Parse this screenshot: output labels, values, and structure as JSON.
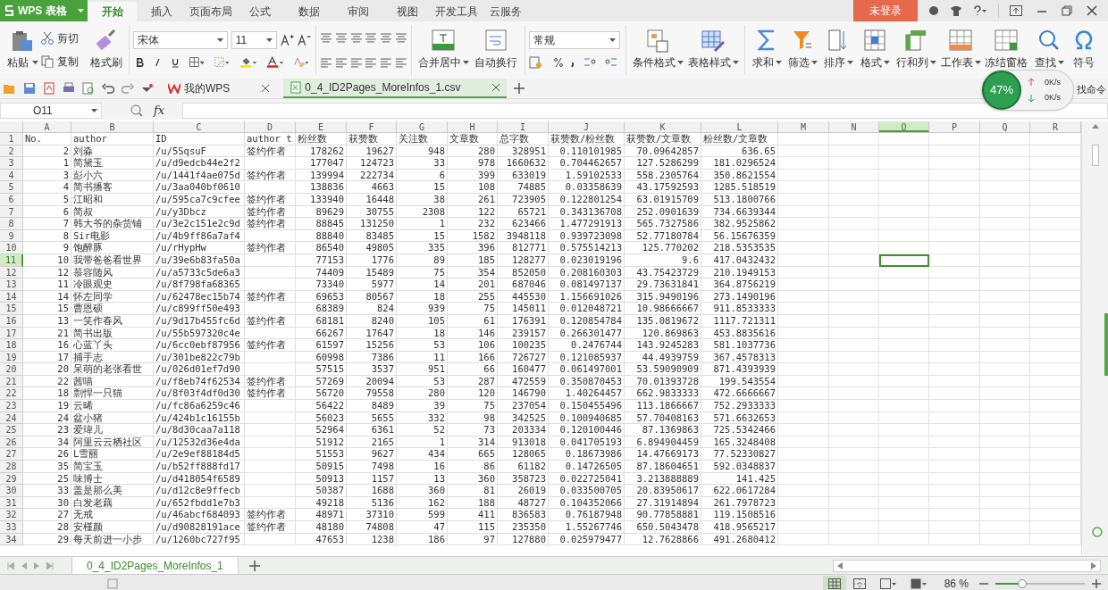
{
  "app": {
    "title": "WPS 表格"
  },
  "menu_tabs": [
    {
      "label": "开始",
      "selected": true
    },
    {
      "label": "插入",
      "selected": false
    },
    {
      "label": "页面布局",
      "selected": false
    },
    {
      "label": "公式",
      "selected": false
    },
    {
      "label": "数据",
      "selected": false
    },
    {
      "label": "审阅",
      "selected": false
    },
    {
      "label": "视图",
      "selected": false
    },
    {
      "label": "开发工具",
      "selected": false
    },
    {
      "label": "云服务",
      "selected": false
    }
  ],
  "account_button": "未登录",
  "ribbon": {
    "paste": "粘贴",
    "cut": "剪切",
    "copy": "复制",
    "format_painter": "格式刷",
    "font": "宋体",
    "font_size": "11",
    "merge": "合并居中",
    "merge_caret": true,
    "wrap": "自动换行",
    "number_format": "常规",
    "tools": [
      {
        "label": "条件格式",
        "caret": true
      },
      {
        "label": "表格样式",
        "caret": true
      }
    ],
    "edit_tools": [
      {
        "kind": "sum",
        "label": "求和",
        "caret": true
      },
      {
        "kind": "filter",
        "label": "筛选",
        "caret": true
      },
      {
        "kind": "sort",
        "label": "排序",
        "caret": true
      },
      {
        "kind": "format",
        "label": "格式",
        "caret": true
      },
      {
        "kind": "rowcol",
        "label": "行和列",
        "caret": true
      },
      {
        "kind": "sheet",
        "label": "工作表",
        "caret": true
      },
      {
        "kind": "freeze",
        "label": "冻结窗格",
        "caret": false
      },
      {
        "kind": "find",
        "label": "查找",
        "caret": true
      },
      {
        "kind": "symbol",
        "label": "符号",
        "caret": false
      }
    ]
  },
  "network_widget": {
    "percent": "47%",
    "upload": "0K/s",
    "download": "0K/s"
  },
  "find_command": "找命令",
  "doc_tabs": [
    {
      "label": "我的WPS",
      "selected": false
    },
    {
      "label": "0_4_ID2Pages_MoreInfos_1.csv",
      "selected": true
    }
  ],
  "formula_bar": {
    "name_box": "O11",
    "fx": "fx"
  },
  "sheet": {
    "columns": [
      {
        "label": "A",
        "selected": false
      },
      {
        "label": "B",
        "selected": false
      },
      {
        "label": "C",
        "selected": false
      },
      {
        "label": "D",
        "selected": false
      },
      {
        "label": "E",
        "selected": false
      },
      {
        "label": "F",
        "selected": false
      },
      {
        "label": "G",
        "selected": false
      },
      {
        "label": "H",
        "selected": false
      },
      {
        "label": "I",
        "selected": false
      },
      {
        "label": "J",
        "selected": false
      },
      {
        "label": "K",
        "selected": false
      },
      {
        "label": "L",
        "selected": false
      },
      {
        "label": "M",
        "selected": false
      },
      {
        "label": "N",
        "selected": false
      },
      {
        "label": "O",
        "selected": true
      },
      {
        "label": "P",
        "selected": false
      },
      {
        "label": "Q",
        "selected": false
      },
      {
        "label": "R",
        "selected": false
      }
    ],
    "rows": [
      {
        "header": "1",
        "selected": false,
        "kind": "heading",
        "cells": {
          "A": "No.",
          "B": "author",
          "C": "ID",
          "D": "author t",
          "E": "粉丝数",
          "F": "获赞数",
          "G": "关注数",
          "H": "文章数",
          "I": "总字数",
          "J": "获赞数/粉丝数",
          "K": "获赞数/文章数",
          "L": "粉丝数/文章数"
        }
      },
      {
        "header": "2",
        "selected": false,
        "kind": "data",
        "cells": {
          "A": "2",
          "B": "刘淼",
          "C": "/u/5SqsuF",
          "D": "签约作者",
          "E": "178262",
          "F": "19627",
          "G": "948",
          "H": "280",
          "I": "328951",
          "J": "0.110101985",
          "K": "70.09642857",
          "L": "636.65"
        }
      },
      {
        "header": "3",
        "selected": false,
        "kind": "data",
        "cells": {
          "A": "1",
          "B": "简黛玉",
          "C": "/u/d9edcb44e2f2",
          "E": "177047",
          "F": "124723",
          "G": "33",
          "H": "978",
          "I": "1660632",
          "J": "0.704462657",
          "K": "127.5286299",
          "L": "181.0296524"
        }
      },
      {
        "header": "4",
        "selected": false,
        "kind": "data",
        "cells": {
          "A": "3",
          "B": "彭小六",
          "C": "/u/1441f4ae075d",
          "D": "签约作者",
          "E": "139994",
          "F": "222734",
          "G": "6",
          "H": "399",
          "I": "633019",
          "J": "1.59102533",
          "K": "558.2305764",
          "L": "350.8621554"
        }
      },
      {
        "header": "5",
        "selected": false,
        "kind": "data",
        "cells": {
          "A": "4",
          "B": "简书播客",
          "C": "/u/3aa040bf0610",
          "E": "138836",
          "F": "4663",
          "G": "15",
          "H": "108",
          "I": "74885",
          "J": "0.03358639",
          "K": "43.17592593",
          "L": "1285.518519"
        }
      },
      {
        "header": "6",
        "selected": false,
        "kind": "data",
        "cells": {
          "A": "5",
          "B": "江昭和",
          "C": "/u/595ca7c9cfee",
          "D": "签约作者",
          "E": "133940",
          "F": "16448",
          "G": "38",
          "H": "261",
          "I": "723905",
          "J": "0.122801254",
          "K": "63.01915709",
          "L": "513.1800766"
        }
      },
      {
        "header": "7",
        "selected": false,
        "kind": "data",
        "cells": {
          "A": "6",
          "B": "简叔",
          "C": "/u/y3Dbcz",
          "D": "签约作者",
          "E": "89629",
          "F": "30755",
          "G": "2308",
          "H": "122",
          "I": "65721",
          "J": "0.343136708",
          "K": "252.0901639",
          "L": "734.6639344"
        }
      },
      {
        "header": "8",
        "selected": false,
        "kind": "data",
        "cells": {
          "A": "7",
          "B": "韩大爷的杂货铺",
          "C": "/u/3e2c151e2c9d",
          "D": "签约作者",
          "E": "88845",
          "F": "131250",
          "G": "1",
          "H": "232",
          "I": "623466",
          "J": "1.477291913",
          "K": "565.7327586",
          "L": "382.9525862"
        }
      },
      {
        "header": "9",
        "selected": false,
        "kind": "data",
        "cells": {
          "A": "8",
          "B": "Sir电影",
          "C": "/u/4b9ff86a7af4",
          "E": "88840",
          "F": "83485",
          "G": "15",
          "H": "1582",
          "I": "3948118",
          "J": "0.939723098",
          "K": "52.77180784",
          "L": "56.15676359"
        }
      },
      {
        "header": "10",
        "selected": false,
        "kind": "data",
        "cells": {
          "A": "9",
          "B": "饱醉豚",
          "C": "/u/rHypHw",
          "D": "签约作者",
          "E": "86540",
          "F": "49805",
          "G": "335",
          "H": "396",
          "I": "812771",
          "J": "0.575514213",
          "K": "125.770202",
          "L": "218.5353535"
        }
      },
      {
        "header": "11",
        "selected": true,
        "kind": "data",
        "cells": {
          "A": "10",
          "B": "我带爸爸看世界",
          "C": "/u/39e6b83fa50a",
          "E": "77153",
          "F": "1776",
          "G": "89",
          "H": "185",
          "I": "128277",
          "J": "0.023019196",
          "K": "9.6",
          "L": "417.0432432"
        }
      },
      {
        "header": "12",
        "selected": false,
        "kind": "data",
        "cells": {
          "A": "12",
          "B": "慕容随风",
          "C": "/u/a5733c5de6a3",
          "E": "74409",
          "F": "15489",
          "G": "75",
          "H": "354",
          "I": "852050",
          "J": "0.208160303",
          "K": "43.75423729",
          "L": "210.1949153"
        }
      },
      {
        "header": "13",
        "selected": false,
        "kind": "data",
        "cells": {
          "A": "11",
          "B": "冷眼观史",
          "C": "/u/8f798fa68365",
          "E": "73340",
          "F": "5977",
          "G": "14",
          "H": "201",
          "I": "687046",
          "J": "0.081497137",
          "K": "29.73631841",
          "L": "364.8756219"
        }
      },
      {
        "header": "14",
        "selected": false,
        "kind": "data",
        "cells": {
          "A": "14",
          "B": "怀左同学",
          "C": "/u/62478ec15b74",
          "D": "签约作者",
          "E": "69653",
          "F": "80567",
          "G": "18",
          "H": "255",
          "I": "445530",
          "J": "1.156691026",
          "K": "315.9490196",
          "L": "273.1490196"
        }
      },
      {
        "header": "15",
        "selected": false,
        "kind": "data",
        "cells": {
          "A": "15",
          "B": "曹恩硕",
          "C": "/u/c899ff50e493",
          "E": "68389",
          "F": "824",
          "G": "939",
          "H": "75",
          "I": "145011",
          "J": "0.012048721",
          "K": "10.98666667",
          "L": "911.8533333"
        }
      },
      {
        "header": "16",
        "selected": false,
        "kind": "data",
        "cells": {
          "A": "13",
          "B": "一笑作春风",
          "C": "/u/9d17b455fc6d",
          "D": "签约作者",
          "E": "68181",
          "F": "8240",
          "G": "105",
          "H": "61",
          "I": "176391",
          "J": "0.120854784",
          "K": "135.0819672",
          "L": "1117.721311"
        }
      },
      {
        "header": "17",
        "selected": false,
        "kind": "data",
        "cells": {
          "A": "21",
          "B": "简书出版",
          "C": "/u/55b597320c4e",
          "E": "66267",
          "F": "17647",
          "G": "18",
          "H": "146",
          "I": "239157",
          "J": "0.266301477",
          "K": "120.869863",
          "L": "453.8835616"
        }
      },
      {
        "header": "18",
        "selected": false,
        "kind": "data",
        "cells": {
          "A": "16",
          "B": "心蓝丫头",
          "C": "/u/6cc0ebf87956",
          "D": "签约作者",
          "E": "61597",
          "F": "15256",
          "G": "53",
          "H": "106",
          "I": "100235",
          "J": "0.2476744",
          "K": "143.9245283",
          "L": "581.1037736"
        }
      },
      {
        "header": "19",
        "selected": false,
        "kind": "data",
        "cells": {
          "A": "17",
          "B": "捕手志",
          "C": "/u/301be822c79b",
          "E": "60998",
          "F": "7386",
          "G": "11",
          "H": "166",
          "I": "726727",
          "J": "0.121085937",
          "K": "44.4939759",
          "L": "367.4578313"
        }
      },
      {
        "header": "20",
        "selected": false,
        "kind": "data",
        "cells": {
          "A": "20",
          "B": "呆萌的老张看世",
          "C": "/u/026d01ef7d90",
          "E": "57515",
          "F": "3537",
          "G": "951",
          "H": "66",
          "I": "160477",
          "J": "0.061497001",
          "K": "53.59090909",
          "L": "871.4393939"
        }
      },
      {
        "header": "21",
        "selected": false,
        "kind": "data",
        "cells": {
          "A": "22",
          "B": "茜喵",
          "C": "/u/f8eb74f62534",
          "D": "签约作者",
          "E": "57269",
          "F": "20094",
          "G": "53",
          "H": "287",
          "I": "472559",
          "J": "0.350870453",
          "K": "70.01393728",
          "L": "199.543554"
        }
      },
      {
        "header": "22",
        "selected": false,
        "kind": "data",
        "cells": {
          "A": "18",
          "B": "剽悍一只猫",
          "C": "/u/8f03f4df0d30",
          "D": "签约作者",
          "E": "56720",
          "F": "79558",
          "G": "280",
          "H": "120",
          "I": "146790",
          "J": "1.40264457",
          "K": "662.9833333",
          "L": "472.6666667"
        }
      },
      {
        "header": "23",
        "selected": false,
        "kind": "data",
        "cells": {
          "A": "19",
          "B": "云晞",
          "C": "/u/fc86a6259c46",
          "E": "56422",
          "F": "8489",
          "G": "39",
          "H": "75",
          "I": "237054",
          "J": "0.150455496",
          "K": "113.1866667",
          "L": "752.2933333"
        }
      },
      {
        "header": "24",
        "selected": false,
        "kind": "data",
        "cells": {
          "A": "24",
          "B": "盆小猪",
          "C": "/u/424b1c16155b",
          "E": "56023",
          "F": "5655",
          "G": "332",
          "H": "98",
          "I": "342525",
          "J": "0.100940685",
          "K": "57.70408163",
          "L": "571.6632653"
        }
      },
      {
        "header": "25",
        "selected": false,
        "kind": "data",
        "cells": {
          "A": "23",
          "B": "爱瑋儿",
          "C": "/u/8d30caa7a118",
          "E": "52964",
          "F": "6361",
          "G": "52",
          "H": "73",
          "I": "203334",
          "J": "0.120100446",
          "K": "87.1369863",
          "L": "725.5342466"
        }
      },
      {
        "header": "26",
        "selected": false,
        "kind": "data",
        "cells": {
          "A": "34",
          "B": "阿里云云栖社区",
          "C": "/u/12532d36e4da",
          "E": "51912",
          "F": "2165",
          "G": "1",
          "H": "314",
          "I": "913018",
          "J": "0.041705193",
          "K": "6.894904459",
          "L": "165.3248408"
        }
      },
      {
        "header": "27",
        "selected": false,
        "kind": "data",
        "cells": {
          "A": "26",
          "B": "L雪丽",
          "C": "/u/2e9ef88184d5",
          "E": "51553",
          "F": "9627",
          "G": "434",
          "H": "665",
          "I": "128065",
          "J": "0.18673986",
          "K": "14.47669173",
          "L": "77.52330827"
        }
      },
      {
        "header": "28",
        "selected": false,
        "kind": "data",
        "cells": {
          "A": "35",
          "B": "简宝玉",
          "C": "/u/b52ff888fd17",
          "E": "50915",
          "F": "7498",
          "G": "16",
          "H": "86",
          "I": "61182",
          "J": "0.14726505",
          "K": "87.18604651",
          "L": "592.0348837"
        }
      },
      {
        "header": "29",
        "selected": false,
        "kind": "data",
        "cells": {
          "A": "25",
          "B": "味博士",
          "C": "/u/d418054f6589",
          "E": "50913",
          "F": "1157",
          "G": "13",
          "H": "360",
          "I": "358723",
          "J": "0.022725041",
          "K": "3.213888889",
          "L": "141.425"
        }
      },
      {
        "header": "30",
        "selected": false,
        "kind": "data",
        "cells": {
          "A": "33",
          "B": "盖是那么美",
          "C": "/u/d12c8e9ffecb",
          "E": "50387",
          "F": "1688",
          "G": "360",
          "H": "81",
          "I": "26019",
          "J": "0.033500705",
          "K": "20.83950617",
          "L": "622.0617284"
        }
      },
      {
        "header": "31",
        "selected": false,
        "kind": "data",
        "cells": {
          "A": "30",
          "B": "白发老藕",
          "C": "/u/652fbdd1e7b3",
          "E": "49218",
          "F": "5136",
          "G": "162",
          "H": "188",
          "I": "48727",
          "J": "0.104352066",
          "K": "27.31914894",
          "L": "261.7978723"
        }
      },
      {
        "header": "32",
        "selected": false,
        "kind": "data",
        "cells": {
          "A": "27",
          "B": "无戒",
          "C": "/u/46abcf684093",
          "D": "签约作者",
          "E": "48971",
          "F": "37310",
          "G": "599",
          "H": "411",
          "I": "836583",
          "J": "0.76187948",
          "K": "90.77858881",
          "L": "119.1508516"
        }
      },
      {
        "header": "33",
        "selected": false,
        "kind": "data",
        "cells": {
          "A": "28",
          "B": "安槿颜",
          "C": "/u/d90828191ace",
          "D": "签约作者",
          "E": "48180",
          "F": "74808",
          "G": "47",
          "H": "115",
          "I": "235350",
          "J": "1.55267746",
          "K": "650.5043478",
          "L": "418.9565217"
        }
      },
      {
        "header": "34",
        "selected": false,
        "kind": "data",
        "cells": {
          "A": "29",
          "B": "每天前进一小步",
          "C": "/u/1260bc727f95",
          "E": "47653",
          "F": "1238",
          "G": "186",
          "H": "97",
          "I": "127880",
          "J": "0.025979477",
          "K": "12.7628866",
          "L": "491.2680412"
        }
      }
    ]
  },
  "sheet_tabs": [
    {
      "label": "0_4_ID2Pages_MoreInfos_1",
      "selected": true
    }
  ],
  "status_bar": {
    "zoom": "86 %",
    "level": 0.3
  }
}
